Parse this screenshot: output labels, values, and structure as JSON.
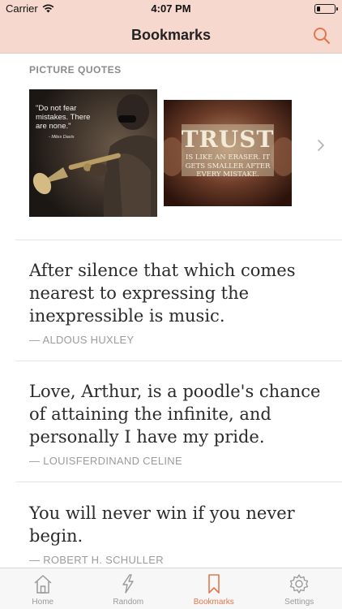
{
  "status_bar": {
    "carrier": "Carrier",
    "time": "4:07 PM",
    "battery_level": 0.2
  },
  "nav": {
    "title": "Bookmarks",
    "search_icon": "search-icon",
    "accent_color": "#e3774c"
  },
  "picture_quotes": {
    "header": "PICTURE QUOTES",
    "items": [
      {
        "quote": "\"Do not fear mistakes. There are none.\"",
        "author": "- Miles Davis"
      },
      {
        "title": "TRUST",
        "quote": "IS LIKE AN ERASER. IT GETS SMALLER AFTER EVERY MISTAKE."
      }
    ],
    "next_icon": "chevron-right-icon"
  },
  "quotes": [
    {
      "text": "After silence that which comes nearest to expressing the inexpressible is music.",
      "author": "— ALDOUS HUXLEY"
    },
    {
      "text": "Love, Arthur, is a poodle's chance of attaining the infinite, and personally I have my pride.",
      "author": "— LOUISFERDINAND CELINE"
    },
    {
      "text": "You will never win if you never begin.",
      "author": "— ROBERT H. SCHULLER"
    }
  ],
  "tabs": [
    {
      "label": "Home",
      "icon": "home-icon",
      "active": false
    },
    {
      "label": "Random",
      "icon": "lightning-icon",
      "active": false
    },
    {
      "label": "Bookmarks",
      "icon": "bookmark-icon",
      "active": true
    },
    {
      "label": "Settings",
      "icon": "gear-icon",
      "active": false
    }
  ]
}
